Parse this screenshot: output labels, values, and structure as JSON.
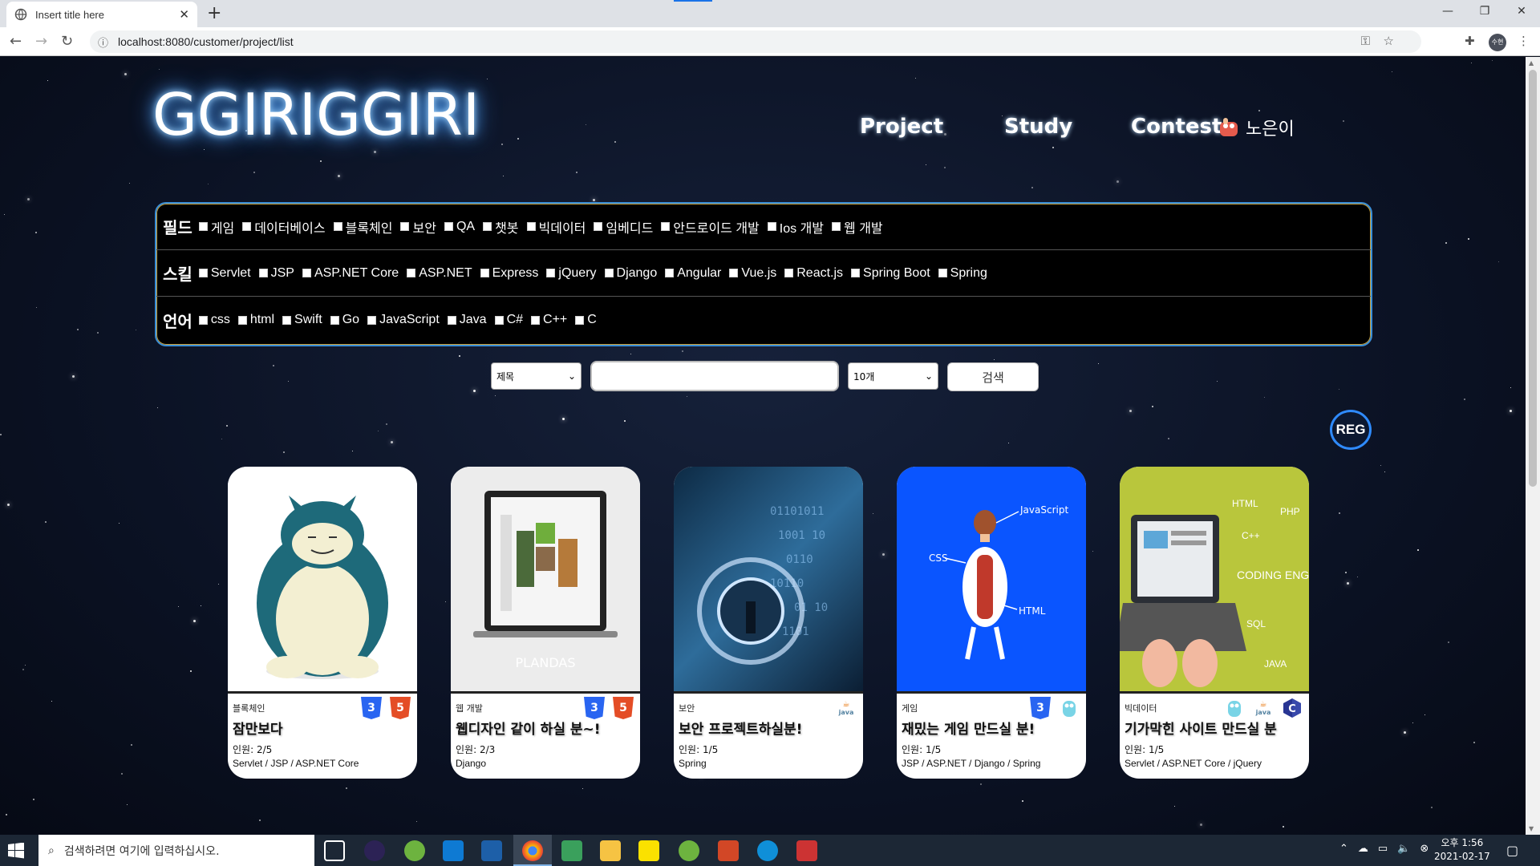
{
  "browser": {
    "tab_title": "Insert title here",
    "new_tab": "+",
    "url": "localhost:8080/customer/project/list",
    "window_controls": [
      "—",
      "❐",
      "✕"
    ],
    "profile_label": "수현"
  },
  "site": {
    "logo": "GGIRIGGIRI",
    "nav": [
      "Project",
      "Study",
      "Contest"
    ],
    "user_name": "노은이"
  },
  "filters": {
    "field": {
      "label": "필드",
      "options": [
        "게임",
        "데이터베이스",
        "블록체인",
        "보안",
        "QA",
        "챗봇",
        "빅데이터",
        "임베디드",
        "안드로이드 개발",
        "Ios 개발",
        "웹 개발"
      ]
    },
    "skill": {
      "label": "스킬",
      "options": [
        "Servlet",
        "JSP",
        "ASP.NET Core",
        "ASP.NET",
        "Express",
        "jQuery",
        "Django",
        "Angular",
        "Vue.js",
        "React.js",
        "Spring Boot",
        "Spring"
      ]
    },
    "language": {
      "label": "언어",
      "options": [
        "css",
        "html",
        "Swift",
        "Go",
        "JavaScript",
        "Java",
        "C#",
        "C++",
        "C"
      ]
    }
  },
  "search": {
    "type_selected": "제목",
    "size_selected": "10개",
    "button": "검색",
    "reg_button": "REG"
  },
  "cards": [
    {
      "field": "블록체인",
      "title": "잠만보다",
      "count": "인원: 2/5",
      "skills": "Servlet / JSP / ASP.NET Core",
      "icons": [
        "css3-icon",
        "html5-icon"
      ]
    },
    {
      "field": "웹 개발",
      "title": "웹디자인 같이 하실 분~!",
      "count": "인원: 2/3",
      "skills": "Django",
      "icons": [
        "css3-icon",
        "html5-icon"
      ],
      "img_text": "PLANDAS"
    },
    {
      "field": "보안",
      "title": "보안 프로젝트하실분!",
      "count": "인원: 1/5",
      "skills": "Spring",
      "icons": [
        "java-icon"
      ]
    },
    {
      "field": "게임",
      "title": "재밌는 게임 만드실 분!",
      "count": "인원: 1/5",
      "skills": "JSP / ASP.NET / Django / Spring",
      "icons": [
        "css3-icon",
        "go-icon"
      ],
      "img_labels": [
        "JavaScript",
        "CSS",
        "HTML"
      ]
    },
    {
      "field": "빅데이터",
      "title": "기가막힌 사이트 만드실 분",
      "count": "인원: 1/5",
      "skills": "Servlet / ASP.NET Core / jQuery",
      "icons": [
        "go-icon",
        "java-icon",
        "c-icon"
      ],
      "img_labels": [
        "HTML",
        "PHP",
        "C++",
        "CODING ENGINE",
        "SQL",
        "JAVA"
      ]
    }
  ],
  "taskbar": {
    "search_placeholder": "검색하려면 여기에 입력하십시오.",
    "time": "오후 1:56",
    "date": "2021-02-17"
  },
  "colors": {
    "panel_border": "#3a8fd8",
    "reg_border": "#2f8bff",
    "css3": "#2965f1",
    "html5": "#e44d26"
  }
}
